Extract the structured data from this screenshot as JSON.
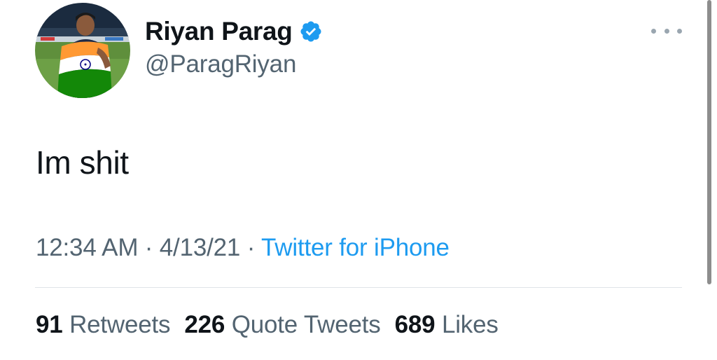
{
  "tweet": {
    "author": {
      "display_name": "Riyan Parag",
      "handle": "@ParagRiyan",
      "verified": true
    },
    "text": "Im shit",
    "time": "12:34 AM",
    "date": "4/13/21",
    "source": "Twitter for iPhone",
    "separator": " · ",
    "stats": {
      "retweets": "91",
      "retweets_label": "Retweets",
      "quote_tweets": "226",
      "quote_tweets_label": "Quote Tweets",
      "likes": "689",
      "likes_label": "Likes"
    }
  },
  "icons": {
    "verified": "verified-badge-icon",
    "more": "more-options-icon"
  },
  "colors": {
    "link_blue": "#1d9bf0",
    "text_primary": "#0f1419",
    "text_secondary": "#536471",
    "verified_blue": "#1d9bf0"
  }
}
